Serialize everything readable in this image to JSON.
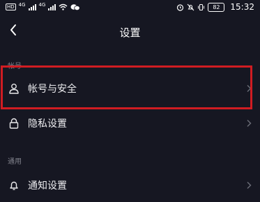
{
  "status_bar": {
    "hd_badge": "HD",
    "net1": "4G",
    "net2": "4G",
    "battery": "82",
    "time": "15:32"
  },
  "header": {
    "title": "设置"
  },
  "sections": [
    {
      "label": "帐号",
      "items": [
        {
          "label": "帐号与安全",
          "icon": "person-icon"
        },
        {
          "label": "隐私设置",
          "icon": "lock-icon"
        }
      ]
    },
    {
      "label": "通用",
      "items": [
        {
          "label": "通知设置",
          "icon": "bell-icon"
        }
      ]
    }
  ],
  "colors": {
    "background": "#161722",
    "highlight": "#d01c22",
    "section_label": "#80828c"
  }
}
